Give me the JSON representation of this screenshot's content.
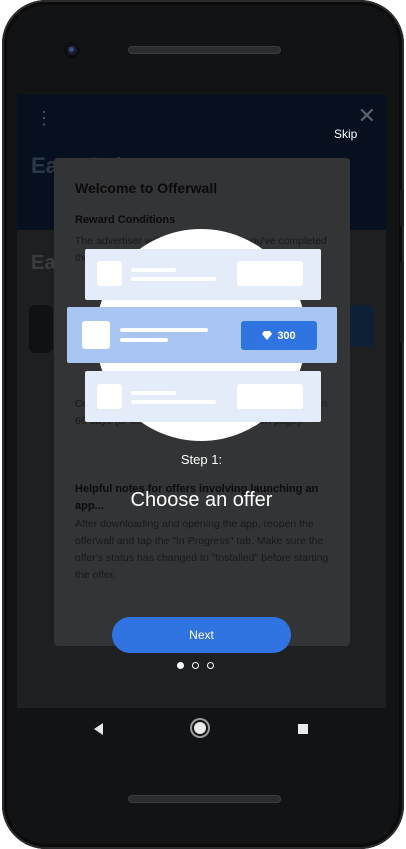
{
  "app": {
    "header_title": "Earn Coins",
    "menu_icon": "⋮",
    "close_icon": "✕",
    "section_title": "Ea"
  },
  "modal": {
    "title": "Welcome to Offerwall",
    "reward_conditions_heading": "Reward Conditions",
    "reward_text": "The advertiser will reward you when you've completed the offer's requirements and...",
    "tracking_text": "Once... same device... page where the offer is... within 60 days (or less, if stated in the instruction page).",
    "helpful_heading": "Helpful notes for offers involving launching an app...",
    "helpful_text": "After downloading and opening the app, reopen the offerwall and tap the \"In Progress\" tab. Make sure the offer's status has changed to \"Installed\" before starting the offer."
  },
  "onboarding": {
    "skip_label": "Skip",
    "step_label": "Step 1:",
    "step_title": "Choose an offer",
    "featured_offer_value": "300",
    "featured_offer_icon": "heart-diamond-icon",
    "next_label": "Next",
    "page_index": 1,
    "page_count": 3
  },
  "colors": {
    "accent_blue": "#2f74e0",
    "card_light": "#e4ecfa",
    "card_featured": "#a9c6f2",
    "overlay": "#2c2d2f"
  },
  "navbar": {
    "back_icon": "back-triangle-icon",
    "home_icon": "home-circle-icon",
    "recents_icon": "recents-square-icon"
  }
}
